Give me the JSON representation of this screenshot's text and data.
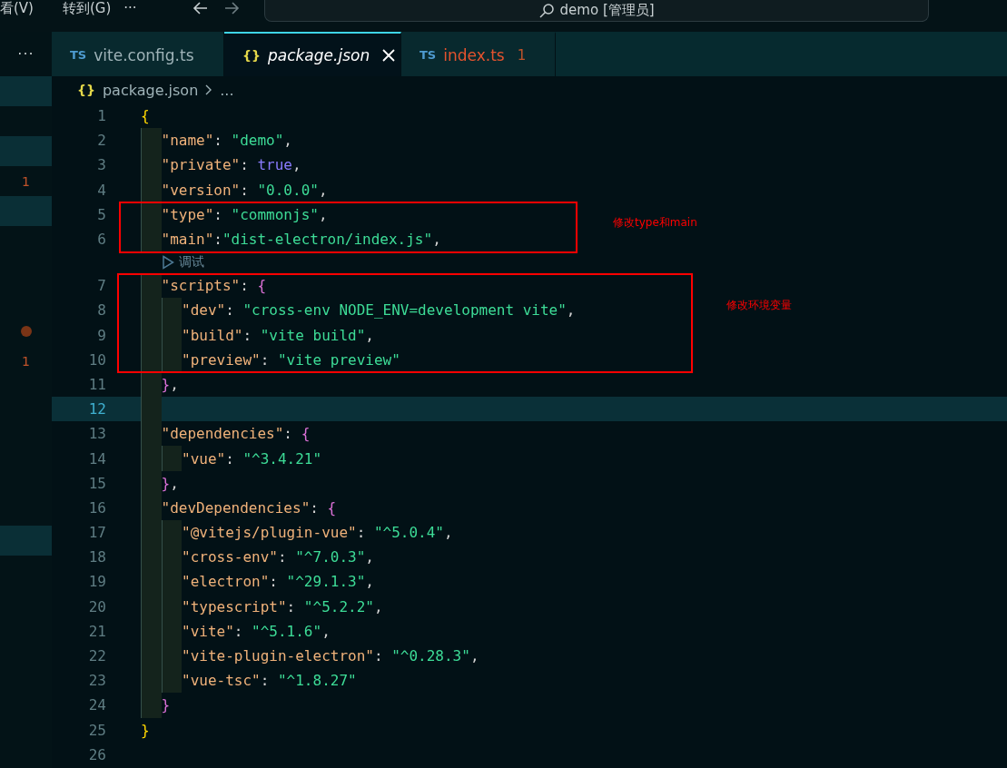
{
  "menu_bar": {
    "items": [
      "看(V)",
      "转到(G)",
      "···"
    ],
    "search": {
      "value": "demo [管理员]"
    }
  },
  "side_panel": {
    "more": "···",
    "rows": [
      {
        "selected": true
      },
      {
        "selected": false
      },
      {
        "selected": true
      },
      {
        "selected": false,
        "badge": "1"
      },
      {
        "selected": true
      },
      {
        "selected": false
      },
      {
        "selected": false
      },
      {
        "selected": false
      },
      {
        "selected": false,
        "dot": true
      },
      {
        "selected": false,
        "badge": "1"
      },
      {
        "selected": false
      },
      {
        "selected": false
      },
      {
        "selected": false
      },
      {
        "selected": false
      },
      {
        "selected": false
      },
      {
        "selected": true
      }
    ]
  },
  "tabs": [
    {
      "icon": "TS",
      "label": "vite.config.ts",
      "selected": false,
      "error": false
    },
    {
      "icon": "{}",
      "label": "package.json",
      "selected": true,
      "error": false
    },
    {
      "icon": "TS",
      "label": "index.ts",
      "selected": false,
      "error": true,
      "problems": "1"
    }
  ],
  "breadcrumb": {
    "icon": "{}",
    "items": [
      "package.json",
      "..."
    ]
  },
  "editor": {
    "lines": [
      {
        "kind": "code",
        "number": "1",
        "selected": false,
        "tokens": [
          {
            "kind": "brace",
            "text": "{"
          }
        ],
        "children": [
          {
            "kind": "code",
            "number": "2",
            "selected": false,
            "tokens": [
              {
                "kind": "key",
                "text": "\"name\""
              },
              {
                "kind": "punct",
                "text": ": "
              },
              {
                "kind": "string",
                "text": "\"demo\""
              },
              {
                "kind": "punct",
                "text": ","
              }
            ]
          },
          {
            "kind": "code",
            "number": "3",
            "selected": false,
            "tokens": [
              {
                "kind": "key",
                "text": "\"private\""
              },
              {
                "kind": "punct",
                "text": ": "
              },
              {
                "kind": "bool",
                "text": "true"
              },
              {
                "kind": "punct",
                "text": ","
              }
            ]
          },
          {
            "kind": "code",
            "number": "4",
            "selected": false,
            "tokens": [
              {
                "kind": "key",
                "text": "\"version\""
              },
              {
                "kind": "punct",
                "text": ": "
              },
              {
                "kind": "string",
                "text": "\"0.0.0\""
              },
              {
                "kind": "punct",
                "text": ","
              }
            ]
          },
          {
            "kind": "code",
            "number": "5",
            "selected": false,
            "tokens": [
              {
                "kind": "key",
                "text": "\"type\""
              },
              {
                "kind": "punct",
                "text": ": "
              },
              {
                "kind": "string",
                "text": "\"commonjs\""
              },
              {
                "kind": "punct",
                "text": ","
              }
            ]
          },
          {
            "kind": "code",
            "number": "6",
            "selected": false,
            "tokens": [
              {
                "kind": "key",
                "text": "\"main\""
              },
              {
                "kind": "punct",
                "text": ":"
              },
              {
                "kind": "string",
                "text": "\"dist-electron/index.js\""
              },
              {
                "kind": "punct",
                "text": ","
              }
            ]
          },
          {
            "kind": "codelens",
            "label": "调试"
          },
          {
            "kind": "code",
            "number": "7",
            "selected": false,
            "tokens": [
              {
                "kind": "key",
                "text": "\"scripts\""
              },
              {
                "kind": "punct",
                "text": ": "
              },
              {
                "kind": "brace",
                "text": "{"
              }
            ],
            "children": [
              {
                "kind": "code",
                "number": "8",
                "selected": false,
                "tokens": [
                  {
                    "kind": "key",
                    "text": "\"dev\""
                  },
                  {
                    "kind": "punct",
                    "text": ": "
                  },
                  {
                    "kind": "string",
                    "text": "\"cross-env NODE_ENV=development vite\""
                  },
                  {
                    "kind": "punct",
                    "text": ","
                  }
                ]
              },
              {
                "kind": "code",
                "number": "9",
                "selected": false,
                "tokens": [
                  {
                    "kind": "key",
                    "text": "\"build\""
                  },
                  {
                    "kind": "punct",
                    "text": ": "
                  },
                  {
                    "kind": "string",
                    "text": "\"vite build\""
                  },
                  {
                    "kind": "punct",
                    "text": ","
                  }
                ]
              },
              {
                "kind": "code",
                "number": "10",
                "selected": false,
                "tokens": [
                  {
                    "kind": "key",
                    "text": "\"preview\""
                  },
                  {
                    "kind": "punct",
                    "text": ": "
                  },
                  {
                    "kind": "string",
                    "text": "\"vite preview\""
                  }
                ]
              }
            ]
          },
          {
            "kind": "code",
            "number": "11",
            "selected": false,
            "tokens": [
              {
                "kind": "brace",
                "text": "}"
              },
              {
                "kind": "punct",
                "text": ","
              }
            ]
          },
          {
            "kind": "code",
            "number": "12",
            "selected": true
          },
          {
            "kind": "code",
            "number": "13",
            "selected": false,
            "tokens": [
              {
                "kind": "key",
                "text": "\"dependencies\""
              },
              {
                "kind": "punct",
                "text": ": "
              },
              {
                "kind": "brace",
                "text": "{"
              }
            ],
            "children": [
              {
                "kind": "code",
                "number": "14",
                "selected": false,
                "tokens": [
                  {
                    "kind": "key",
                    "text": "\"vue\""
                  },
                  {
                    "kind": "punct",
                    "text": ": "
                  },
                  {
                    "kind": "string",
                    "text": "\"^3.4.21\""
                  }
                ]
              }
            ]
          },
          {
            "kind": "code",
            "number": "15",
            "selected": false,
            "tokens": [
              {
                "kind": "brace",
                "text": "}"
              },
              {
                "kind": "punct",
                "text": ","
              }
            ]
          },
          {
            "kind": "code",
            "number": "16",
            "selected": false,
            "tokens": [
              {
                "kind": "key",
                "text": "\"devDependencies\""
              },
              {
                "kind": "punct",
                "text": ": "
              },
              {
                "kind": "brace",
                "text": "{"
              }
            ],
            "children": [
              {
                "kind": "code",
                "number": "17",
                "selected": false,
                "tokens": [
                  {
                    "kind": "key",
                    "text": "\"@vitejs/plugin-vue\""
                  },
                  {
                    "kind": "punct",
                    "text": ": "
                  },
                  {
                    "kind": "string",
                    "text": "\"^5.0.4\""
                  },
                  {
                    "kind": "punct",
                    "text": ","
                  }
                ]
              },
              {
                "kind": "code",
                "number": "18",
                "selected": false,
                "tokens": [
                  {
                    "kind": "key",
                    "text": "\"cross-env\""
                  },
                  {
                    "kind": "punct",
                    "text": ": "
                  },
                  {
                    "kind": "string",
                    "text": "\"^7.0.3\""
                  },
                  {
                    "kind": "punct",
                    "text": ","
                  }
                ]
              },
              {
                "kind": "code",
                "number": "19",
                "selected": false,
                "tokens": [
                  {
                    "kind": "key",
                    "text": "\"electron\""
                  },
                  {
                    "kind": "punct",
                    "text": ": "
                  },
                  {
                    "kind": "string",
                    "text": "\"^29.1.3\""
                  },
                  {
                    "kind": "punct",
                    "text": ","
                  }
                ]
              },
              {
                "kind": "code",
                "number": "20",
                "selected": false,
                "tokens": [
                  {
                    "kind": "key",
                    "text": "\"typescript\""
                  },
                  {
                    "kind": "punct",
                    "text": ": "
                  },
                  {
                    "kind": "string",
                    "text": "\"^5.2.2\""
                  },
                  {
                    "kind": "punct",
                    "text": ","
                  }
                ]
              },
              {
                "kind": "code",
                "number": "21",
                "selected": false,
                "tokens": [
                  {
                    "kind": "key",
                    "text": "\"vite\""
                  },
                  {
                    "kind": "punct",
                    "text": ": "
                  },
                  {
                    "kind": "string",
                    "text": "\"^5.1.6\""
                  },
                  {
                    "kind": "punct",
                    "text": ","
                  }
                ]
              },
              {
                "kind": "code",
                "number": "22",
                "selected": false,
                "tokens": [
                  {
                    "kind": "key",
                    "text": "\"vite-plugin-electron\""
                  },
                  {
                    "kind": "punct",
                    "text": ": "
                  },
                  {
                    "kind": "string",
                    "text": "\"^0.28.3\""
                  },
                  {
                    "kind": "punct",
                    "text": ","
                  }
                ]
              },
              {
                "kind": "code",
                "number": "23",
                "selected": false,
                "tokens": [
                  {
                    "kind": "key",
                    "text": "\"vue-tsc\""
                  },
                  {
                    "kind": "punct",
                    "text": ": "
                  },
                  {
                    "kind": "string",
                    "text": "\"^1.8.27\""
                  }
                ]
              }
            ]
          },
          {
            "kind": "code",
            "number": "24",
            "selected": false,
            "tokens": [
              {
                "kind": "brace",
                "text": "}"
              }
            ]
          }
        ]
      },
      {
        "kind": "code",
        "number": "25",
        "selected": false,
        "tokens": [
          {
            "kind": "brace",
            "text": "}"
          }
        ]
      },
      {
        "kind": "code",
        "number": "26",
        "selected": false
      }
    ]
  },
  "annotations": [
    {
      "label": "修改type和main"
    },
    {
      "label": "修改环境变量"
    }
  ]
}
